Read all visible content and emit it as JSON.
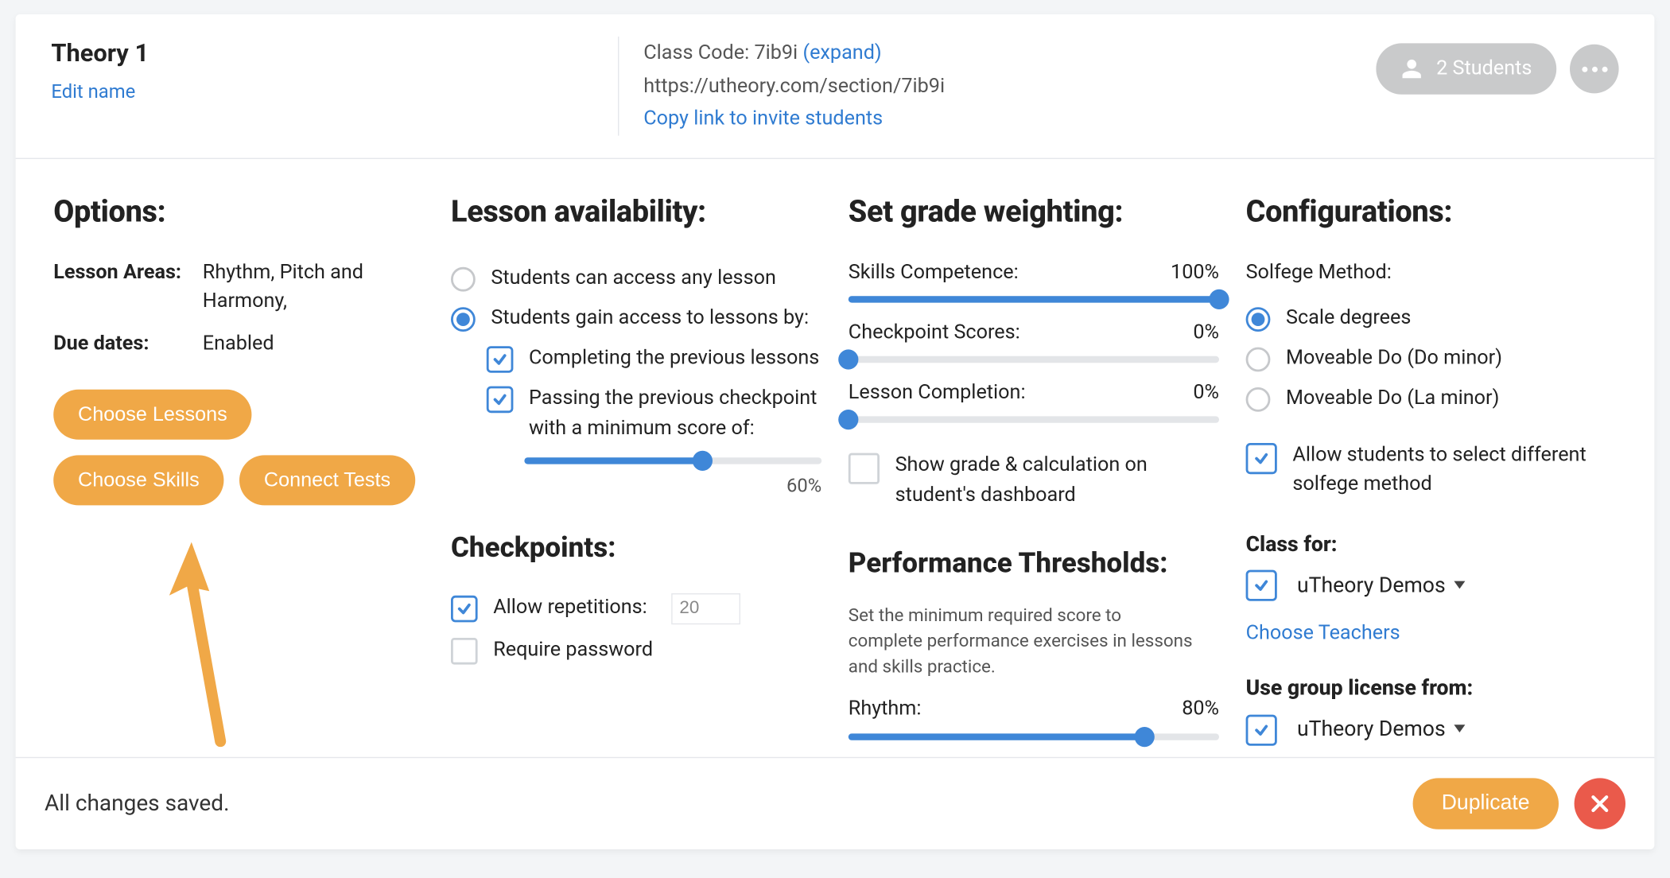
{
  "header": {
    "class_name": "Theory 1",
    "edit_name": "Edit name",
    "class_code_label": "Class Code:",
    "class_code": "7ib9i",
    "expand": "(expand)",
    "class_url": "https://utheory.com/section/7ib9i",
    "copy_link": "Copy link to invite students",
    "students_pill": "2 Students"
  },
  "options": {
    "heading": "Options:",
    "rows": [
      {
        "label": "Lesson Areas:",
        "value": "Rhythm, Pitch and Harmony,"
      },
      {
        "label": "Due dates:",
        "value": "Enabled"
      }
    ],
    "buttons": {
      "choose_lessons": "Choose Lessons",
      "choose_skills": "Choose Skills",
      "connect_tests": "Connect Tests"
    }
  },
  "availability": {
    "heading": "Lesson availability:",
    "choices": [
      {
        "text": "Students can access any lesson",
        "selected": false
      },
      {
        "text": "Students gain access to lessons by:",
        "selected": true
      }
    ],
    "conditions": [
      {
        "text": "Completing the previous lessons",
        "checked": true
      },
      {
        "text": "Passing the previous checkpoint with a minimum score of:",
        "checked": true
      }
    ],
    "min_score_percent": 60,
    "min_score_label": "60%"
  },
  "checkpoints": {
    "heading": "Checkpoints:",
    "allow_repetitions_label": "Allow repetitions:",
    "allow_repetitions_checked": true,
    "repetitions": "20",
    "require_password_label": "Require password",
    "require_password_checked": false
  },
  "weighting": {
    "heading": "Set grade weighting:",
    "items": [
      {
        "label": "Skills Competence:",
        "value": "100%",
        "pct": 100
      },
      {
        "label": "Checkpoint Scores:",
        "value": "0%",
        "pct": 0
      },
      {
        "label": "Lesson Completion:",
        "value": "0%",
        "pct": 0
      }
    ],
    "show_grade_label": "Show grade & calculation on student's dashboard",
    "show_grade_checked": false
  },
  "thresholds": {
    "heading": "Performance Thresholds:",
    "description": "Set the minimum required score to complete performance exercises in lessons and skills practice.",
    "items": [
      {
        "label": "Rhythm:",
        "value": "80%",
        "pct": 80
      }
    ]
  },
  "config": {
    "heading": "Configurations:",
    "solfege_label": "Solfege Method:",
    "solfege_options": [
      {
        "text": "Scale degrees",
        "selected": true
      },
      {
        "text": "Moveable Do (Do minor)",
        "selected": false
      },
      {
        "text": "Moveable Do (La minor)",
        "selected": false
      }
    ],
    "allow_student_select_label": "Allow students to select different solfege method",
    "allow_student_select_checked": true,
    "class_for_label": "Class for:",
    "class_for_value": "uTheory Demos",
    "class_for_checked": true,
    "choose_teachers": "Choose Teachers",
    "license_label": "Use group license from:",
    "license_value": "uTheory Demos",
    "license_checked": true
  },
  "footer": {
    "status": "All changes saved.",
    "duplicate": "Duplicate"
  }
}
